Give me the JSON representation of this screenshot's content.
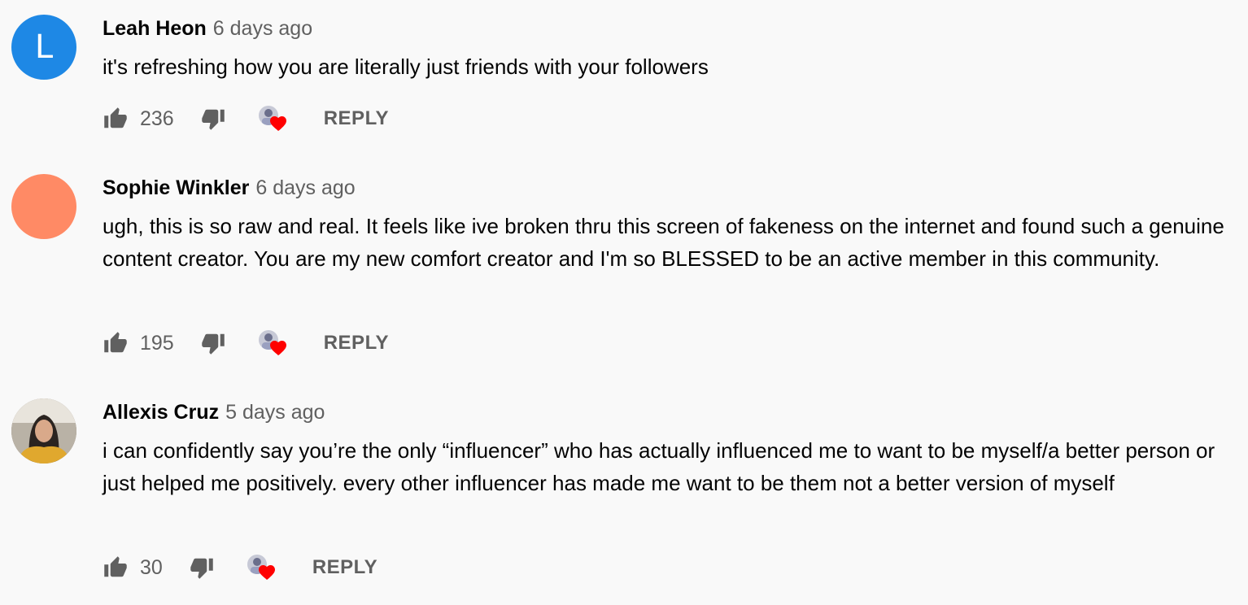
{
  "comments": [
    {
      "avatar_letter": "L",
      "avatar_color": "#1e88e5",
      "author": "Leah Heon",
      "time": "6 days ago",
      "text": "it's refreshing how you are literally just friends with your followers",
      "likes": "236",
      "reply_label": "REPLY"
    },
    {
      "avatar_letter": "",
      "avatar_color": "#ff8a65",
      "author": "Sophie Winkler",
      "time": "6 days ago",
      "text": "ugh, this is so raw and real. It feels like ive broken thru this screen of fakeness on the internet and found such a genuine content creator. You are my new comfort creator and I'm so BLESSED to be an active member in this community.",
      "likes": "195",
      "reply_label": "REPLY"
    },
    {
      "avatar_letter": "",
      "avatar_color": "#8d7b6a",
      "author": "Allexis Cruz",
      "time": "5 days ago",
      "text": "i can confidently say you’re the only “influencer” who has actually influenced me to want to be myself/a better person or just helped me positively. every other influencer has made me want to be them not a better version of myself",
      "likes": "30",
      "reply_label": "REPLY"
    }
  ],
  "icons": {
    "like": "thumb-up-icon",
    "dislike": "thumb-down-icon",
    "creator_heart": "creator-heart-icon"
  },
  "colors": {
    "background": "#f9f9f9",
    "secondary_text": "#606060",
    "heart": "#ff0000"
  }
}
